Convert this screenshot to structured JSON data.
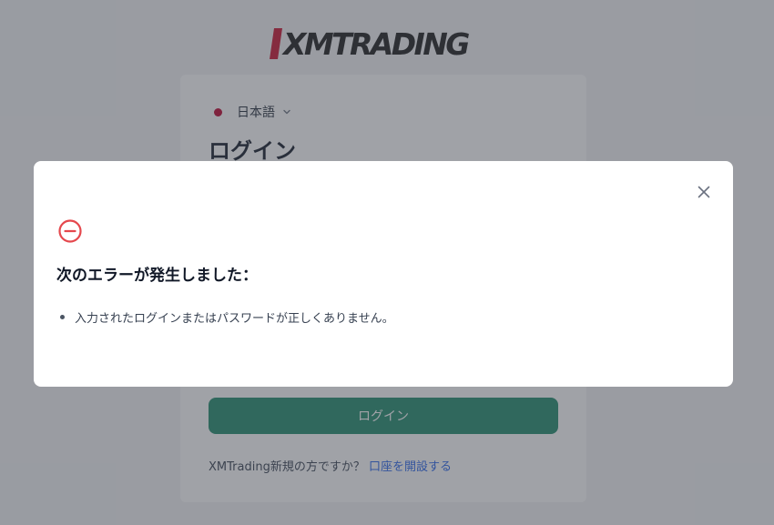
{
  "brand": {
    "logo_text": "XMTRADING",
    "logo_accent_color": "#c8102e"
  },
  "login_page": {
    "language": {
      "label": "日本語",
      "flag_color": "#bc002d"
    },
    "title": "ログイン",
    "submit_label": "ログイン",
    "signup_prompt": "XMTrading新規の方ですか？",
    "signup_link": "口座を開設する",
    "primary_color": "#1f8a6a",
    "link_color": "#2563eb"
  },
  "error_modal": {
    "title": "次のエラーが発生しました：",
    "errors": [
      "入力されたログインまたはパスワードが正しくありません。"
    ],
    "icon": "minus-circle-icon",
    "icon_color": "#e5484d",
    "close_icon": "close-icon"
  }
}
